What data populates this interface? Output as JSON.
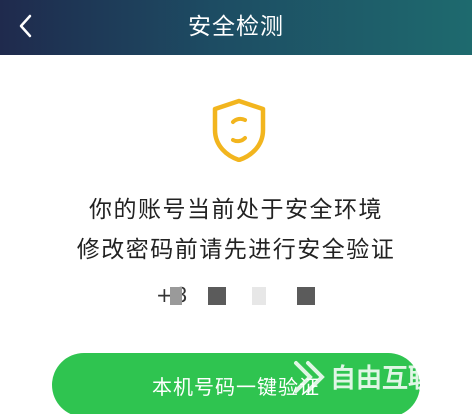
{
  "header": {
    "title": "安全检测",
    "back_icon": "chevron-left-icon"
  },
  "status": {
    "icon": "shield-icon",
    "line1": "你的账号当前处于安全环境",
    "line2": "修改密码前请先进行安全验证"
  },
  "phone": {
    "masked_number": "+8"
  },
  "actions": {
    "verify_label": "本机号码一键验证"
  },
  "watermark": {
    "text": "自由互联"
  },
  "colors": {
    "header_start": "#1f2a4d",
    "header_end": "#1e6a6e",
    "accent": "#f2b51e",
    "button": "#2fc450"
  }
}
